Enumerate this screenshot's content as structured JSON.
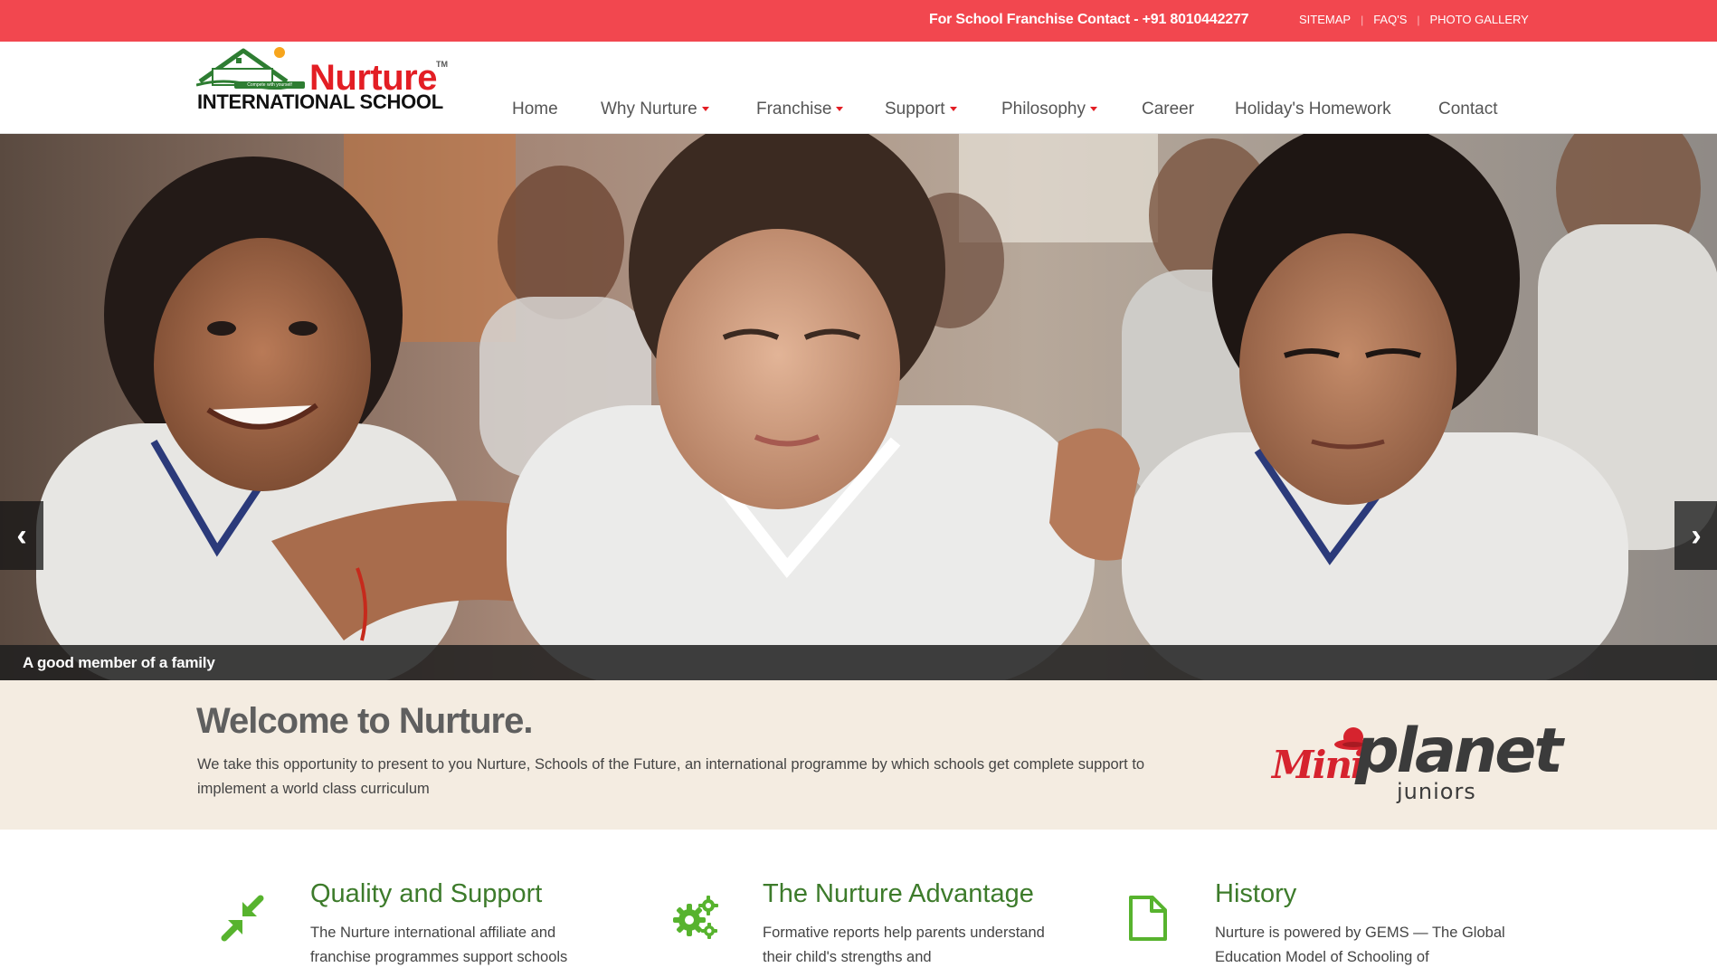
{
  "topbar": {
    "contact": "For School Franchise Contact - +91 8010442277",
    "links": [
      "SITEMAP",
      "FAQ'S",
      "PHOTO GALLERY"
    ]
  },
  "logo": {
    "brand": "Nurture",
    "trademark": "TM",
    "subtitle": "INTERNATIONAL SCHOOL",
    "tagline": "Compete with yourself"
  },
  "nav": {
    "items": [
      {
        "label": "Home",
        "dropdown": false
      },
      {
        "label": "Why Nurture",
        "dropdown": true
      },
      {
        "label": "Franchise",
        "dropdown": true
      },
      {
        "label": "Support",
        "dropdown": true
      },
      {
        "label": "Philosophy",
        "dropdown": true
      },
      {
        "label": "Career",
        "dropdown": false
      },
      {
        "label": "Holiday's Homework",
        "dropdown": false
      },
      {
        "label": "Contact",
        "dropdown": false
      }
    ]
  },
  "hero": {
    "caption": "A good member of a family",
    "prev_icon": "chevron-left-icon",
    "next_icon": "chevron-right-icon"
  },
  "welcome": {
    "title": "Welcome to Nurture.",
    "text": "We take this opportunity to present to you Nurture, Schools of the Future, an international programme by which schools get complete support to implement a world class curriculum",
    "partner_logo": {
      "word1": "Mini",
      "word2": "planet",
      "word3": "juniors"
    }
  },
  "features": [
    {
      "icon": "compress-arrows-icon",
      "title": "Quality and Support",
      "text": "The Nurture international affiliate and franchise programmes support schools"
    },
    {
      "icon": "gears-icon",
      "title": "The Nurture Advantage",
      "text": "Formative reports help parents understand their child's strengths and"
    },
    {
      "icon": "document-icon",
      "title": "History",
      "text": "Nurture is powered by GEMS — The Global Education Model of Schooling of"
    }
  ],
  "colors": {
    "topbar": "#f2474f",
    "brand_red": "#e31e24",
    "green": "#3d7b2b",
    "icon_green": "#57b32e",
    "welcome_bg": "#f4ece1"
  }
}
